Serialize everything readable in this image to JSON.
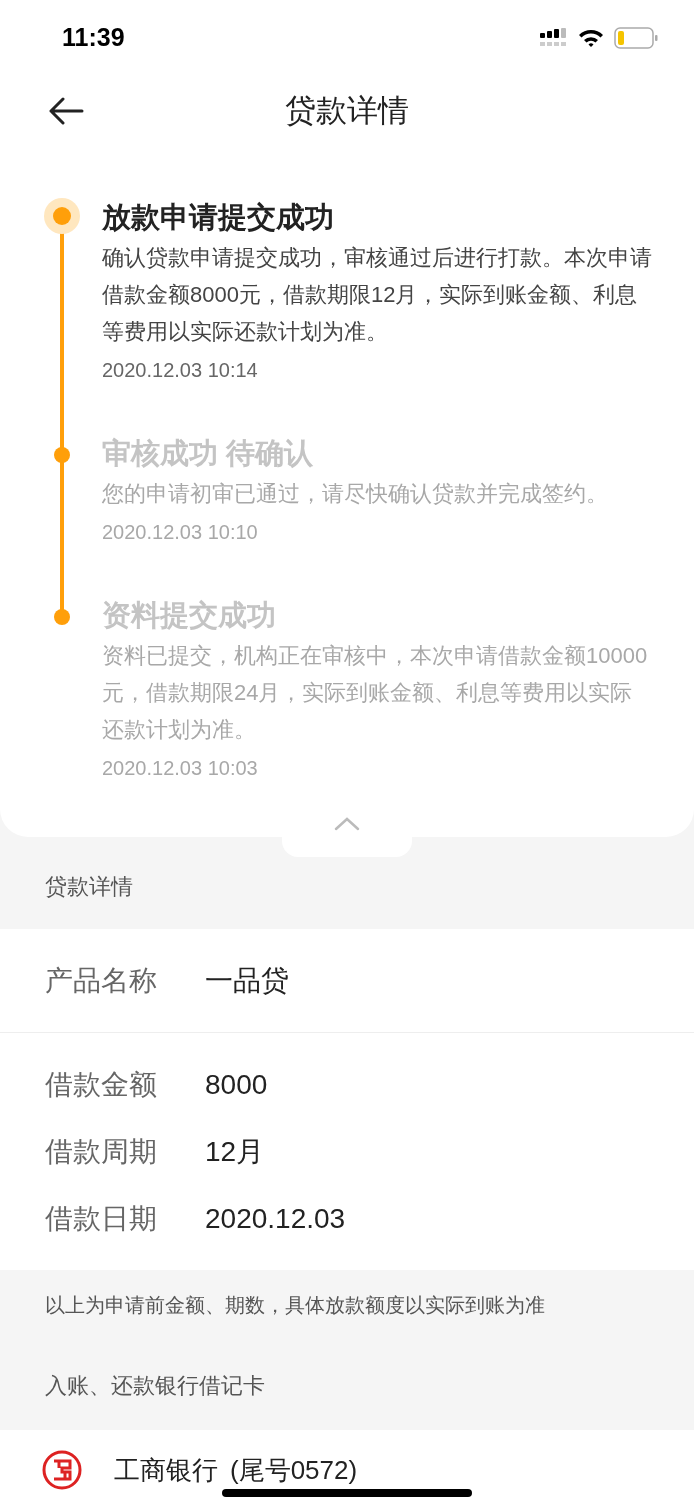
{
  "status_bar": {
    "time": "11:39"
  },
  "header": {
    "title": "贷款详情"
  },
  "timeline": [
    {
      "title": "放款申请提交成功",
      "description": "确认贷款申请提交成功，审核通过后进行打款。本次申请借款金额8000元，借款期限12月，实际到账金额、利息等费用以实际还款计划为准。",
      "time": "2020.12.03 10:14",
      "active": true
    },
    {
      "title": "审核成功 待确认",
      "description": "您的申请初审已通过，请尽快确认贷款并完成签约。",
      "time": "2020.12.03 10:10",
      "active": false
    },
    {
      "title": "资料提交成功",
      "description": "资料已提交，机构正在审核中，本次申请借款金额10000元，借款期限24月，实际到账金额、利息等费用以实际还款计划为准。",
      "time": "2020.12.03 10:03",
      "active": false
    }
  ],
  "details_section": {
    "label": "贷款详情"
  },
  "product": {
    "label": "产品名称",
    "value": "一品贷"
  },
  "loan_fields": [
    {
      "label": "借款金额",
      "value": "8000"
    },
    {
      "label": "借款周期",
      "value": "12月"
    },
    {
      "label": "借款日期",
      "value": "2020.12.03"
    }
  ],
  "note": "以上为申请前金额、期数，具体放款额度以实际到账为准",
  "bank_section": {
    "label": "入账、还款银行借记卡"
  },
  "bank": {
    "name": "工商银行",
    "account": "(尾号0572)"
  }
}
